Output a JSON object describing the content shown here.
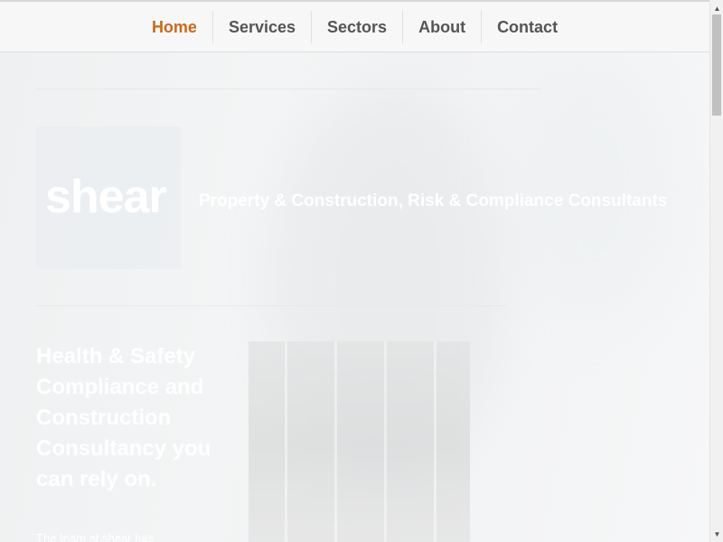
{
  "nav": {
    "items": [
      {
        "label": "Home",
        "active": true
      },
      {
        "label": "Services",
        "active": false
      },
      {
        "label": "Sectors",
        "active": false
      },
      {
        "label": "About",
        "active": false
      },
      {
        "label": "Contact",
        "active": false
      }
    ]
  },
  "hero": {
    "logo": "shear",
    "tagline": "Property & Construction, Risk & Compliance Consultants"
  },
  "intro": {
    "headline": "Health & Safety Compliance and Construction Consultancy you can rely on.",
    "body_start": "The team at shear has"
  },
  "colors": {
    "accent": "#c8691c",
    "nav_text": "#555555"
  },
  "scrollbar": {
    "up_icon": "arrow-up-icon",
    "down_icon": "arrow-down-icon"
  }
}
